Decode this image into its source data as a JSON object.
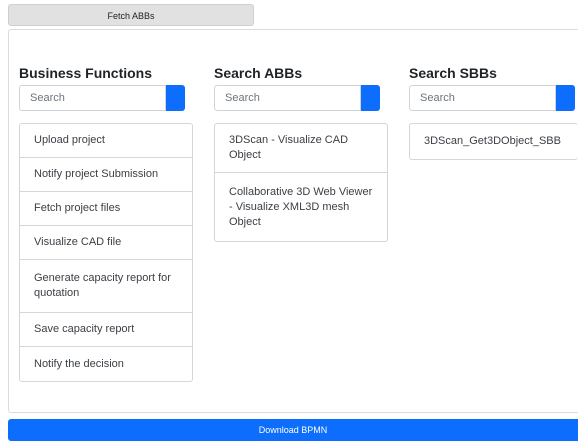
{
  "fetch_button": "Fetch ABBs",
  "columns": [
    {
      "title": "Business Functions",
      "search_placeholder": "Search",
      "items": [
        "Upload project",
        "Notify project Submission",
        "Fetch project files",
        "Visualize CAD file",
        "Generate capacity report for quotation",
        "Save capacity report",
        "Notify the decision"
      ]
    },
    {
      "title": "Search ABBs",
      "search_placeholder": "Search",
      "items": [
        "3DScan - Visualize CAD Object",
        "Collaborative 3D Web Viewer - Visualize XML3D mesh Object"
      ]
    },
    {
      "title": "Search SBBs",
      "search_placeholder": "Search",
      "items": [
        "3DScan_Get3DObject_SBB"
      ]
    }
  ],
  "download_button": "Download BPMN",
  "colors": {
    "primary": "#0d6efd",
    "secondary": "#e1e1e1"
  }
}
